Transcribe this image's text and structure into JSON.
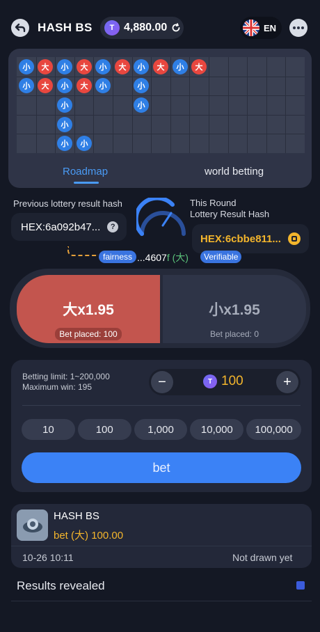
{
  "header": {
    "title": "HASH BS",
    "balance": "4,880.00",
    "coin_glyph": "T",
    "language": "EN"
  },
  "roadmap": {
    "tabs": [
      "Roadmap",
      "world betting"
    ],
    "active_tab": "Roadmap",
    "beads_row1": [
      "小",
      "大",
      "小",
      "大",
      "小",
      "大",
      "小",
      "大",
      "小",
      "大"
    ],
    "beads": [
      {
        "col": 0,
        "row": 0,
        "t": "小"
      },
      {
        "col": 1,
        "row": 0,
        "t": "大"
      },
      {
        "col": 2,
        "row": 0,
        "t": "小"
      },
      {
        "col": 3,
        "row": 0,
        "t": "大"
      },
      {
        "col": 4,
        "row": 0,
        "t": "小"
      },
      {
        "col": 5,
        "row": 0,
        "t": "大"
      },
      {
        "col": 6,
        "row": 0,
        "t": "小"
      },
      {
        "col": 7,
        "row": 0,
        "t": "大"
      },
      {
        "col": 8,
        "row": 0,
        "t": "小"
      },
      {
        "col": 9,
        "row": 0,
        "t": "大"
      },
      {
        "col": 0,
        "row": 1,
        "t": "小"
      },
      {
        "col": 1,
        "row": 1,
        "t": "大"
      },
      {
        "col": 2,
        "row": 1,
        "t": "小"
      },
      {
        "col": 3,
        "row": 1,
        "t": "大"
      },
      {
        "col": 4,
        "row": 1,
        "t": "小"
      },
      {
        "col": 6,
        "row": 1,
        "t": "小"
      },
      {
        "col": 2,
        "row": 2,
        "t": "小"
      },
      {
        "col": 6,
        "row": 2,
        "t": "小"
      },
      {
        "col": 2,
        "row": 3,
        "t": "小"
      },
      {
        "col": 2,
        "row": 4,
        "t": "小"
      },
      {
        "col": 3,
        "row": 4,
        "t": "小"
      }
    ]
  },
  "hash": {
    "previous_label": "Previous lottery result hash",
    "previous_value": "HEX:6a092b47...",
    "round_label_1": "This Round",
    "round_label_2": "Lottery Result Hash",
    "round_value": "HEX:6cbbe811...",
    "fairness_badge": "fairness",
    "result_prefix": "...4607",
    "result_hl": "f",
    "result_outcome": "(大)",
    "verifiable_badge": "Verifiable"
  },
  "options": {
    "big_label": "大x1.95",
    "big_placed": "Bet placed: 100",
    "small_label": "小x1.95",
    "small_placed": "Bet placed: 0"
  },
  "betting": {
    "limit": "Betting limit: 1~200,000",
    "max_win": "Maximum win: 195",
    "amount": "100",
    "minus": "−",
    "plus": "+",
    "chips": [
      "10",
      "100",
      "1,000",
      "10,000",
      "100,000"
    ],
    "bet_button": "bet"
  },
  "history": {
    "game": "HASH BS",
    "bet_prefix": "bet",
    "bet_side": "(大)",
    "bet_amount": "100.00",
    "time": "10-26 10:11",
    "status": "Not drawn yet"
  },
  "results": {
    "label": "Results revealed"
  },
  "colors": {
    "accent": "#3b82f6",
    "big": "#e8473f",
    "small": "#2f7fe5",
    "gold": "#f3b52c"
  }
}
